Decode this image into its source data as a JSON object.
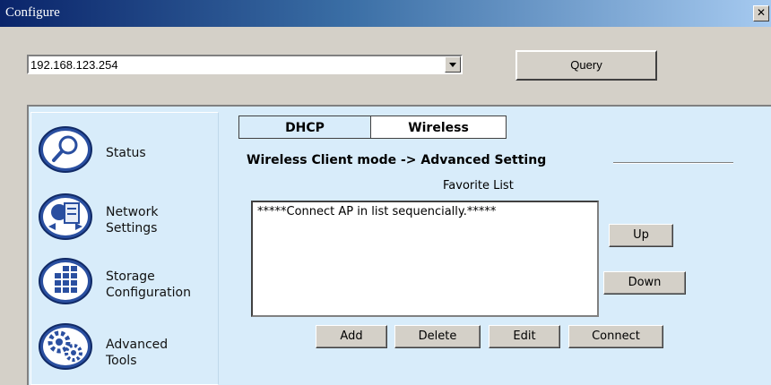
{
  "window": {
    "title": "Configure"
  },
  "address": {
    "value": "192.168.123.254"
  },
  "toolbar": {
    "query_label": "Query"
  },
  "nav": {
    "items": [
      {
        "label": "Status",
        "icon": "magnifier-icon"
      },
      {
        "label": "Network\nSettings",
        "icon": "network-settings-icon"
      },
      {
        "label": "Storage\nConfiguration",
        "icon": "storage-icon"
      },
      {
        "label": "Advanced\nTools",
        "icon": "gears-icon"
      }
    ]
  },
  "tabs": [
    {
      "label": "DHCP",
      "active": false
    },
    {
      "label": "Wireless",
      "active": true
    }
  ],
  "section": {
    "heading": "Wireless Client mode -> Advanced Setting",
    "favorite_label": "Favorite List",
    "list_items": [
      "*****Connect AP in list sequencially.*****"
    ]
  },
  "buttons": {
    "up": "Up",
    "down": "Down",
    "add": "Add",
    "delete": "Delete",
    "edit": "Edit",
    "connect": "Connect"
  },
  "colors": {
    "title_bar": "#0a246a",
    "panel_bg": "#d8ecfa",
    "icon_blue": "#2a4fa0"
  }
}
